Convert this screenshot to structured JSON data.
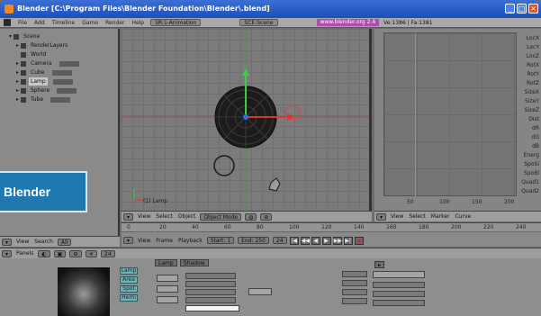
{
  "window": {
    "title": "Blender [C:\\Program Files\\Blender Foundation\\Blender\\.blend]"
  },
  "menu": {
    "items": [
      "File",
      "Add",
      "Timeline",
      "Game",
      "Render",
      "Help"
    ],
    "screen_select": "SR:1-Animation",
    "scene_select": "SCE:Scene",
    "url_badge": "www.blender.org 2.4",
    "ve_info": "Ve:1386 | Fa:1381"
  },
  "outliner": {
    "rows": [
      {
        "label": "Scene",
        "indent": 1
      },
      {
        "label": "RenderLayers",
        "indent": 2
      },
      {
        "label": "World",
        "indent": 2
      },
      {
        "label": "Camera",
        "indent": 2
      },
      {
        "label": "Cube",
        "indent": 2
      },
      {
        "label": "Lamp",
        "indent": 2
      },
      {
        "label": "Sphere",
        "indent": 2
      },
      {
        "label": "Tube",
        "indent": 2
      }
    ],
    "header": {
      "view": "View",
      "search": "Search",
      "all": "All"
    }
  },
  "viewport": {
    "object_label": "(1) Lamp",
    "header": {
      "view": "View",
      "select": "Select",
      "object": "Object",
      "mode": "Object Mode"
    }
  },
  "ipo": {
    "channels": [
      "LocX",
      "LocY",
      "LocZ",
      "RotX",
      "RotY",
      "RotZ",
      "SizeX",
      "SizeY",
      "SizeZ",
      "Dist",
      "dR",
      "dG",
      "dB",
      "Energ",
      "SpoSi",
      "SpoBl",
      "Quad1",
      "Quad2"
    ],
    "ticks": [
      "50",
      "100",
      "150",
      "200"
    ],
    "header": {
      "view": "View",
      "select": "Select",
      "marker": "Marker",
      "curve": "Curve"
    }
  },
  "timeline": {
    "ruler": [
      "0",
      "20",
      "40",
      "60",
      "80",
      "100",
      "120",
      "140",
      "160",
      "180",
      "200",
      "220",
      "240"
    ],
    "header": {
      "view": "View",
      "frame": "Frame",
      "playback": "Playback",
      "start": "Start: 1",
      "end": "End: 250",
      "current": "24"
    },
    "transport": [
      "|◀",
      "◀◀",
      "◀",
      "▶",
      "▶▶",
      "▶|"
    ]
  },
  "buttons": {
    "header": {
      "panels": "Panels",
      "frame": "24"
    },
    "tabs": [
      "Lamp",
      "Shadow"
    ],
    "blue_buttons": [
      "Lamp",
      "Area",
      "Spot",
      "Hemi"
    ],
    "fields": [
      "Dist: 25.00",
      "Energy: 1.000",
      "R 1.000",
      "G 1.000",
      "B 1.000"
    ]
  },
  "badge": {
    "text": "Blender"
  }
}
